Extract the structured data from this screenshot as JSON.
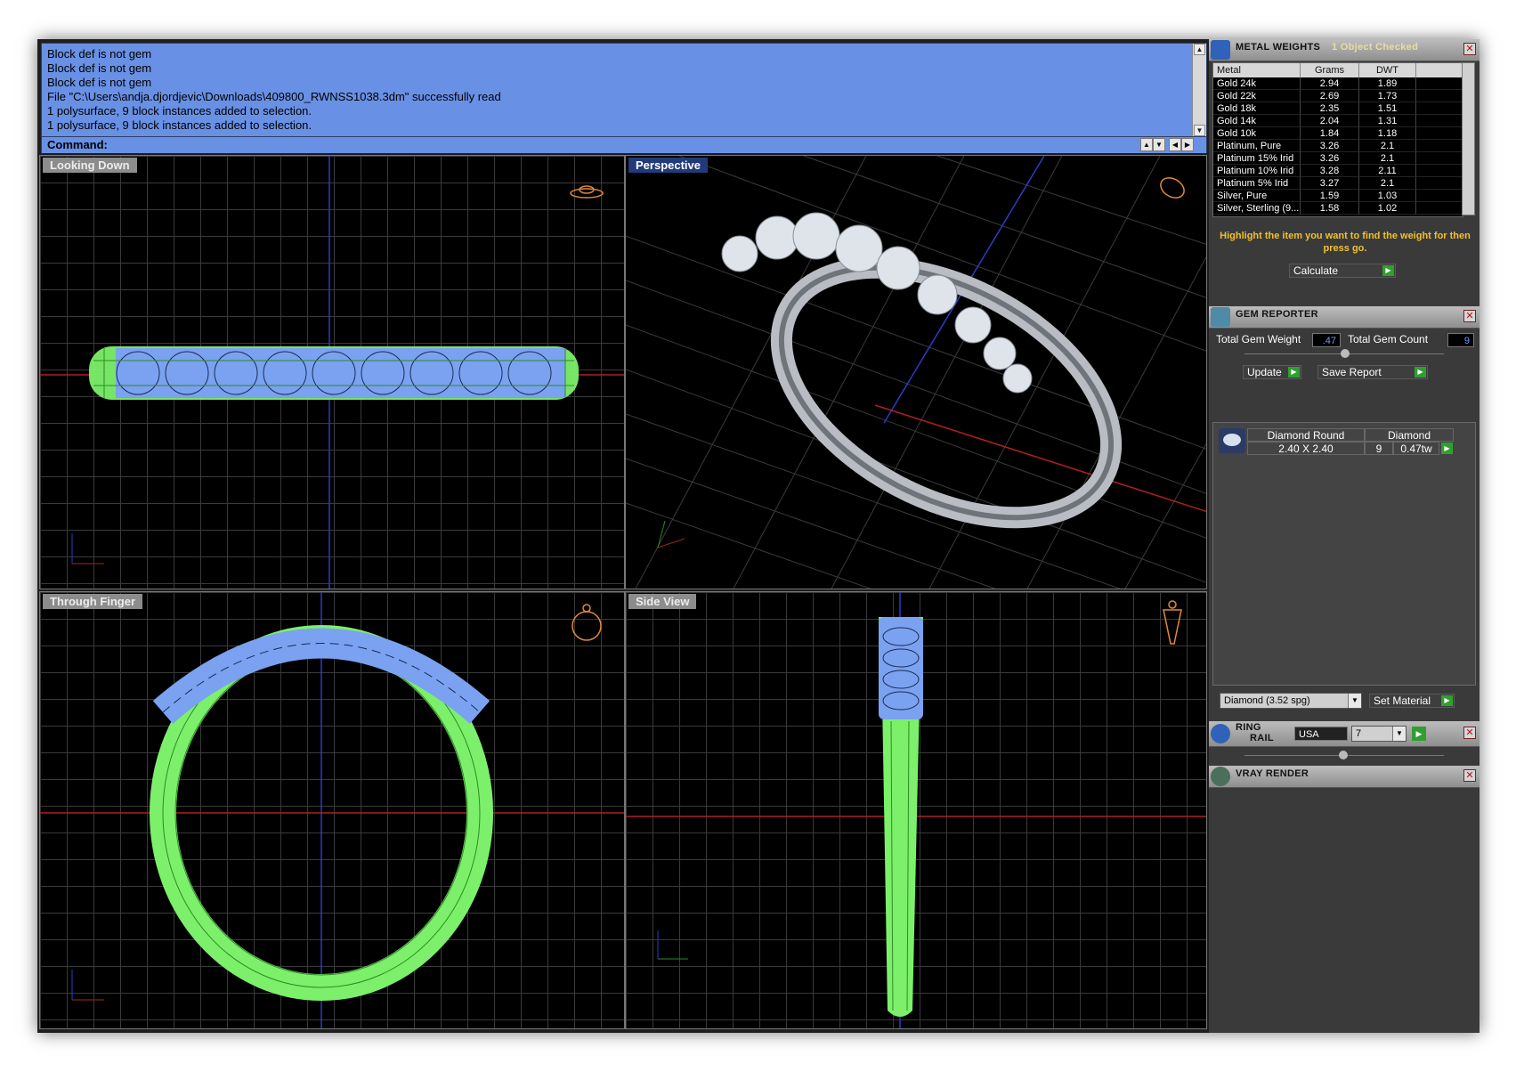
{
  "command": {
    "lines": [
      "Block def is not gem",
      "Block def is not gem",
      "Block def is not gem",
      "File \"C:\\Users\\andja.djordjevic\\Downloads\\409800_RWNSS1038.3dm\" successfully read",
      "1 polysurface, 9 block instances added to selection.",
      "1 polysurface, 9 block instances added to selection."
    ],
    "prompt": "Command:"
  },
  "viewports": {
    "top_left": "Looking Down",
    "top_right": "Perspective",
    "bottom_left": "Through Finger",
    "bottom_right": "Side View"
  },
  "metal_weights": {
    "title": "METAL WEIGHTS",
    "status": "1 Object Checked",
    "columns": [
      "Metal",
      "Grams",
      "DWT"
    ],
    "rows": [
      {
        "metal": "Gold 24k",
        "grams": "2.94",
        "dwt": "1.89"
      },
      {
        "metal": "Gold 22k",
        "grams": "2.69",
        "dwt": "1.73"
      },
      {
        "metal": "Gold 18k",
        "grams": "2.35",
        "dwt": "1.51"
      },
      {
        "metal": "Gold 14k",
        "grams": "2.04",
        "dwt": "1.31"
      },
      {
        "metal": "Gold 10k",
        "grams": "1.84",
        "dwt": "1.18"
      },
      {
        "metal": "Platinum, Pure",
        "grams": "3.26",
        "dwt": "2.1"
      },
      {
        "metal": "Platinum 15% Irid",
        "grams": "3.26",
        "dwt": "2.1"
      },
      {
        "metal": "Platinum 10% Irid",
        "grams": "3.28",
        "dwt": "2.11"
      },
      {
        "metal": "Platinum 5% Irid",
        "grams": "3.27",
        "dwt": "2.1"
      },
      {
        "metal": "Silver, Pure",
        "grams": "1.59",
        "dwt": "1.03"
      },
      {
        "metal": "Silver, Sterling (9...",
        "grams": "1.58",
        "dwt": "1.02"
      }
    ],
    "hint": "Highlight the item you want to find the weight for then press go.",
    "calculate": "Calculate"
  },
  "gem_reporter": {
    "title": "GEM REPORTER",
    "total_weight_label": "Total Gem Weight",
    "total_weight": ".47",
    "total_count_label": "Total Gem Count",
    "total_count": "9",
    "update": "Update",
    "save_report": "Save Report",
    "gem": {
      "name": "Diamond Round",
      "type": "Diamond",
      "size": "2.40 X 2.40",
      "count": "9",
      "weight": "0.47tw"
    },
    "material": "Diamond    (3.52 spg)",
    "set_material": "Set Material"
  },
  "ring_rail": {
    "title_1": "RING",
    "title_2": "RAIL",
    "region": "USA",
    "size": "7"
  },
  "vray": {
    "title": "VRAY RENDER"
  },
  "colors": {
    "command_bg": "#6890e4",
    "wire": "#7cf06a",
    "gem": "#7aa2f0",
    "hint": "#f2c12e"
  }
}
